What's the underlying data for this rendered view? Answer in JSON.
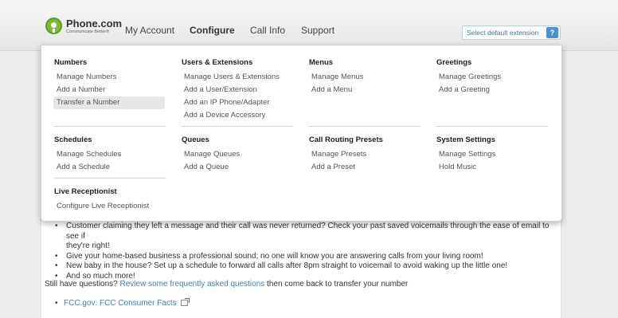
{
  "brand": {
    "name": "Phone.com",
    "tagline": "Communicate Better®"
  },
  "nav": {
    "my_account": "My Account",
    "configure": "Configure",
    "call_info": "Call Info",
    "support": "Support"
  },
  "extension_button": {
    "label": "Select default extension",
    "help": "?"
  },
  "menu": {
    "numbers": {
      "title": "Numbers",
      "items": [
        "Manage Numbers",
        "Add a Number",
        "Transfer a Number"
      ]
    },
    "users": {
      "title": "Users & Extensions",
      "items": [
        "Manage Users & Extensions",
        "Add a User/Extension",
        "Add an IP Phone/Adapter",
        "Add a Device Accessory"
      ]
    },
    "menus": {
      "title": "Menus",
      "items": [
        "Manage Menus",
        "Add a Menu"
      ]
    },
    "greetings": {
      "title": "Greetings",
      "items": [
        "Manage Greetings",
        "Add a Greeting"
      ]
    },
    "schedules": {
      "title": "Schedules",
      "items": [
        "Manage Schedules",
        "Add a Schedule"
      ]
    },
    "queues": {
      "title": "Queues",
      "items": [
        "Manage Queues",
        "Add a Queue"
      ]
    },
    "presets": {
      "title": "Call Routing Presets",
      "items": [
        "Manage Presets",
        "Add a Preset"
      ]
    },
    "system": {
      "title": "System Settings",
      "items": [
        "Manage Settings",
        "Hold Music"
      ]
    },
    "receptionist": {
      "title": "Live Receptionist",
      "items": [
        "Configure Live Receptionist"
      ]
    }
  },
  "content": {
    "tips": [
      "Customer claiming they left a message and their call was never returned? Check your past saved voicemails through the ease of email to see if",
      "they're right!",
      "Give your home-based business a professional sound; no one will know you are answering calls from your living room!",
      "New baby in the house? Set up a schedule to forward all calls after 8pm straight to voicemail to avoid waking up the little one!",
      "And so much more!"
    ],
    "still_prefix": "Still have questions? ",
    "faq_link": "Review some frequently asked questions",
    "still_suffix": " then come back to transfer your number",
    "fcc_link": "FCC.gov: FCC Consumer Facts"
  },
  "colors": {
    "accent": "#3f7fb5",
    "brand_green": "#7dbb2f",
    "help_blue": "#4b93d0"
  }
}
